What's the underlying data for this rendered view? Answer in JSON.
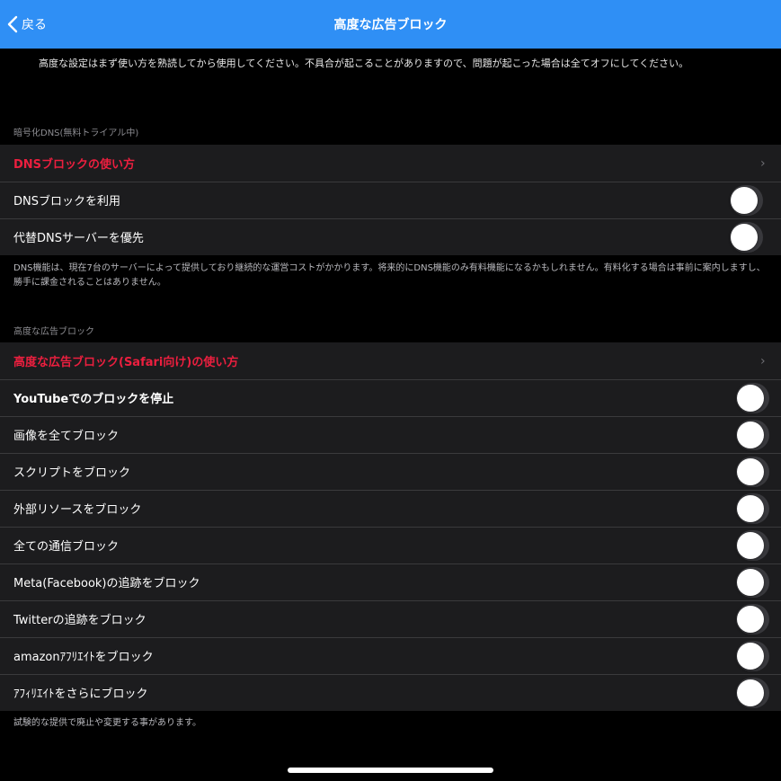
{
  "nav": {
    "back_label": "戻る",
    "title": "高度な広告ブロック"
  },
  "intro_text": "高度な設定はまず使い方を熟読してから使用してください。不具合が起こることがありますので、問題が起こった場合は全てオフにしてください。",
  "dns_section": {
    "header": "暗号化DNS(無料トライアル中)",
    "howto_label": "DNSブロックの使い方",
    "items": [
      {
        "label": "DNSブロックを利用",
        "enabled": false
      },
      {
        "label": "代替DNSサーバーを優先",
        "enabled": false
      }
    ],
    "footer_line1": "DNS機能は、現在7台のサーバーによって提供しており継続的な運営コストがかかります。将来的にDNS機能のみ有料機能になるかもしれません。有料化する場合は事前に案内しますし、",
    "footer_line2": "勝手に課金されることはありません。"
  },
  "adblock_section": {
    "header": "高度な広告ブロック",
    "howto_label": "高度な広告ブロック(Safari向け)の使い方",
    "items": [
      {
        "label": "YouTubeでのブロックを停止",
        "enabled": false
      },
      {
        "label": "画像を全てブロック",
        "enabled": false
      },
      {
        "label": "スクリプトをブロック",
        "enabled": false
      },
      {
        "label": "外部リソースをブロック",
        "enabled": false
      },
      {
        "label": "全ての通信ブロック",
        "enabled": false
      },
      {
        "label": "Meta(Facebook)の追跡をブロック",
        "enabled": false
      },
      {
        "label": "Twitterの追跡をブロック",
        "enabled": false
      },
      {
        "label": "amazonｱﾌﾘｴｲﾄをブロック",
        "enabled": false
      },
      {
        "label": "ｱﾌｨﾘｴｲﾄをさらにブロック",
        "enabled": false
      }
    ],
    "footer": "試験的な提供で廃止や変更する事があります。"
  },
  "icons": {
    "back": "chevron-left-icon",
    "disclosure": "chevron-right-icon"
  },
  "colors": {
    "nav_bar": "#2f8ff5",
    "link_red": "#ec1f3f",
    "background": "#000000",
    "cell": "#1c1c1e",
    "toggle_off": "#39393d"
  }
}
